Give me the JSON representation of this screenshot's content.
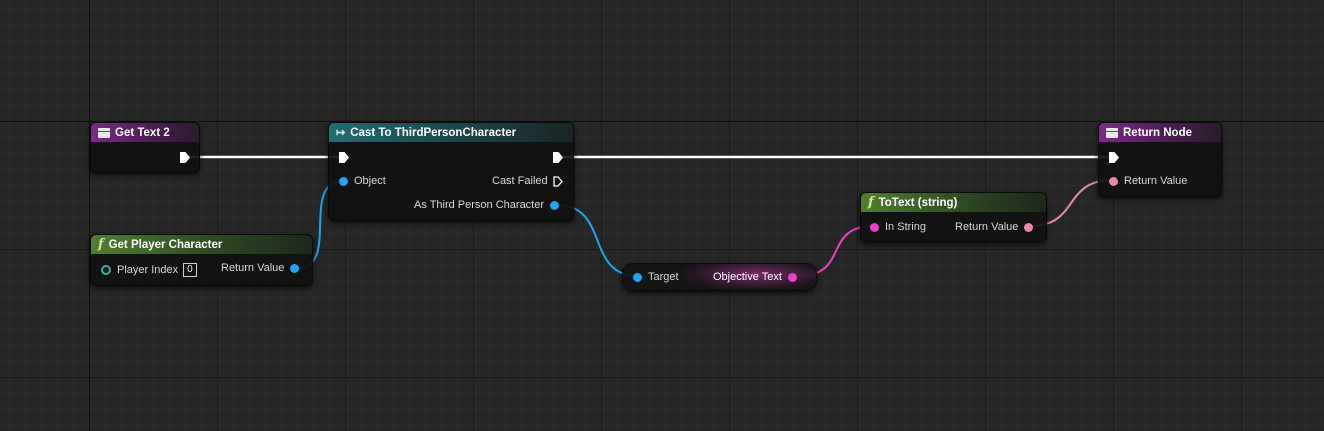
{
  "nodes": {
    "get_text": {
      "title": "Get Text 2"
    },
    "get_player_character": {
      "title": "Get Player Character",
      "player_index_label": "Player Index",
      "player_index_value": "0",
      "return_label": "Return Value"
    },
    "cast": {
      "title": "Cast To ThirdPersonCharacter",
      "object_label": "Object",
      "cast_failed_label": "Cast Failed",
      "as_label": "As Third Person Character"
    },
    "objective_text": {
      "target_label": "Target",
      "output_label": "Objective Text"
    },
    "to_text": {
      "title": "ToText (string)",
      "in_label": "In String",
      "return_label": "Return Value"
    },
    "return_node": {
      "title": "Return Node",
      "return_label": "Return Value"
    }
  },
  "colors": {
    "background": "#262626",
    "exec_wire": "#ffffff",
    "object_pin": "#1aa6f0",
    "string_pin": "#f03cc8",
    "text_pin": "#e88aa6",
    "function_header": "#4f7f2f",
    "event_header": "#7d2a8a",
    "cast_header": "#1f6f72"
  }
}
